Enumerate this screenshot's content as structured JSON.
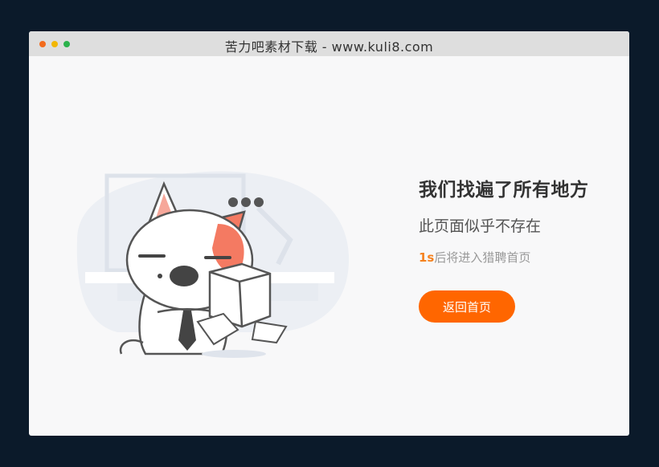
{
  "window": {
    "title": "苦力吧素材下载 - www.kuli8.com"
  },
  "error_page": {
    "heading": "我们找遍了所有地方",
    "subheading": "此页面似乎不存在",
    "redirect": {
      "seconds": "1s",
      "text": "后将进入猎聘首页"
    },
    "home_button_label": "返回首页"
  },
  "illustration": {
    "icon": "cat-with-box-illustration"
  },
  "colors": {
    "accent": "#ff6600",
    "countdown": "#f5821f",
    "background": "#0b1a2a",
    "page": "#f8f8f9"
  }
}
